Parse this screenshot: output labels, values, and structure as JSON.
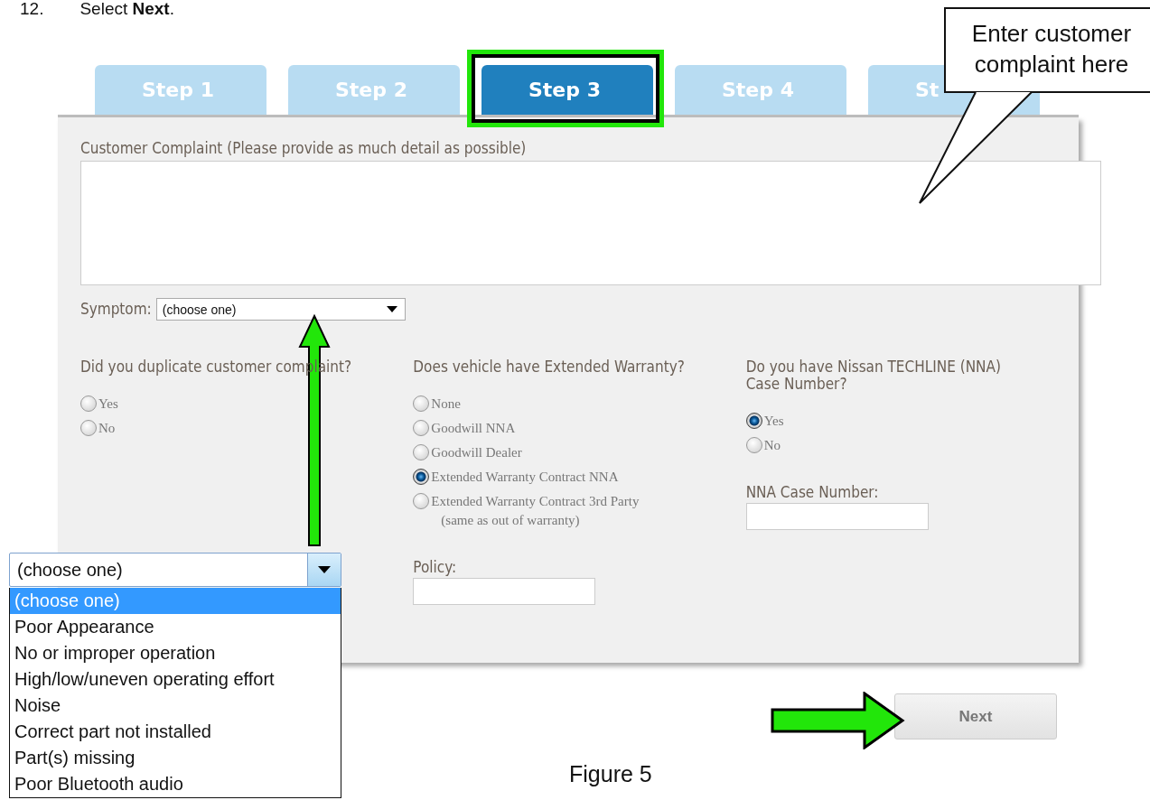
{
  "instruction": {
    "number": "12.",
    "text": "Select **Next**."
  },
  "tabs": [
    {
      "label": "Step 1",
      "selected": false
    },
    {
      "label": "Step 2",
      "selected": false
    },
    {
      "label": "Step 3",
      "selected": true
    },
    {
      "label": "Step 4",
      "selected": false
    },
    {
      "label": "St",
      "selected": false
    }
  ],
  "complaint": {
    "label": "Customer Complaint (Please provide as much detail as possible)"
  },
  "symptom": {
    "label": "Symptom:",
    "value": "(choose one)"
  },
  "questions": [
    {
      "label": "Did you duplicate customer complaint?",
      "options": [
        {
          "label": "Yes",
          "selected": false
        },
        {
          "label": "No",
          "selected": false
        }
      ]
    },
    {
      "label": "Does vehicle have Extended Warranty?",
      "options": [
        {
          "label": "None",
          "selected": false
        },
        {
          "label": "Goodwill NNA",
          "selected": false
        },
        {
          "label": "Goodwill Dealer",
          "selected": false
        },
        {
          "label": "Extended Warranty Contract NNA",
          "selected": true
        },
        {
          "label": "Extended Warranty Contract 3rd Party",
          "note": "(same as out of warranty)",
          "selected": false
        }
      ],
      "field": {
        "label": "Policy:"
      }
    },
    {
      "label": "Do you have Nissan TECHLINE (NNA) Case Number?",
      "options": [
        {
          "label": "Yes",
          "selected": true
        },
        {
          "label": "No",
          "selected": false
        }
      ],
      "field": {
        "label": "NNA Case Number:"
      }
    }
  ],
  "dropdown": {
    "value": "(choose one)",
    "options": [
      {
        "label": "(choose one)",
        "selected": true
      },
      {
        "label": "Poor Appearance",
        "selected": false
      },
      {
        "label": "No or improper operation",
        "selected": false
      },
      {
        "label": "High/low/uneven operating effort",
        "selected": false
      },
      {
        "label": "Noise",
        "selected": false
      },
      {
        "label": "Correct part not installed",
        "selected": false
      },
      {
        "label": "Part(s) missing",
        "selected": false
      },
      {
        "label": "Poor Bluetooth audio",
        "selected": false
      }
    ]
  },
  "next_button": "Next",
  "callout": "Enter customer complaint here",
  "caption": "Figure 5"
}
